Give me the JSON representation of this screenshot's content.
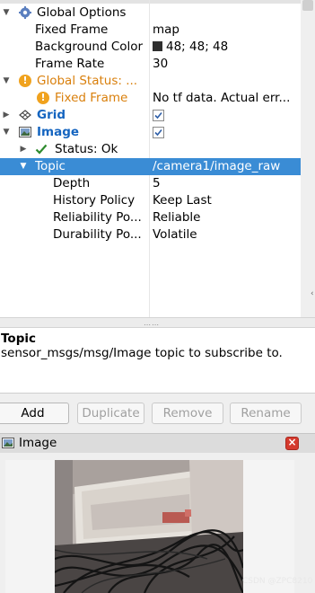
{
  "tree": {
    "rows": [
      {
        "name": "Global Options",
        "value": ""
      },
      {
        "name": "Fixed Frame",
        "value": "map"
      },
      {
        "name": "Background Color",
        "value": "48; 48; 48"
      },
      {
        "name": "Frame Rate",
        "value": "30"
      },
      {
        "name": "Global Status: ...",
        "value": ""
      },
      {
        "name": "Fixed Frame",
        "value": "No tf data.  Actual err..."
      },
      {
        "name": "Grid",
        "value": ""
      },
      {
        "name": "Image",
        "value": ""
      },
      {
        "name": "Status: Ok",
        "value": ""
      },
      {
        "name": "Topic",
        "value": "/camera1/image_raw"
      },
      {
        "name": "Depth",
        "value": "5"
      },
      {
        "name": "History Policy",
        "value": "Keep Last"
      },
      {
        "name": "Reliability Po...",
        "value": "Reliable"
      },
      {
        "name": "Durability Po...",
        "value": "Volatile"
      }
    ],
    "background_swatch_color": "#303030",
    "grid_checked": true,
    "image_checked": true,
    "selected_row_color": "#3a8cd5",
    "warning_color": "#f0a21e"
  },
  "description": {
    "title": "Topic",
    "text": "sensor_msgs/msg/Image topic to subscribe to."
  },
  "buttons": {
    "add": "Add",
    "duplicate": "Duplicate",
    "remove": "Remove",
    "rename": "Rename"
  },
  "image_panel": {
    "title": "Image"
  },
  "watermark": "CSDN @ZPC8210"
}
